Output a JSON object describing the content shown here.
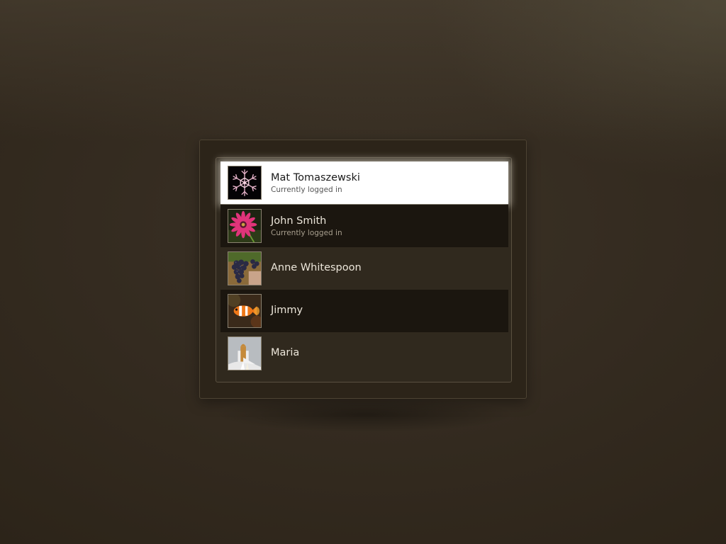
{
  "users": [
    {
      "name": "Mat Tomaszewski",
      "status": "Currently logged in",
      "avatar": "snowflake-icon",
      "selected": true
    },
    {
      "name": "John Smith",
      "status": "Currently logged in",
      "avatar": "pink-flower-icon",
      "selected": false
    },
    {
      "name": "Anne Whitespoon",
      "status": "",
      "avatar": "grapes-icon",
      "selected": false
    },
    {
      "name": "Jimmy",
      "status": "",
      "avatar": "clownfish-icon",
      "selected": false
    },
    {
      "name": "Maria",
      "status": "",
      "avatar": "space-shuttle-icon",
      "selected": false
    }
  ],
  "colors": {
    "background": "#342b20",
    "frame": "#2c2419",
    "row_dark": "#1b160f",
    "selected_row": "#ffffff"
  }
}
